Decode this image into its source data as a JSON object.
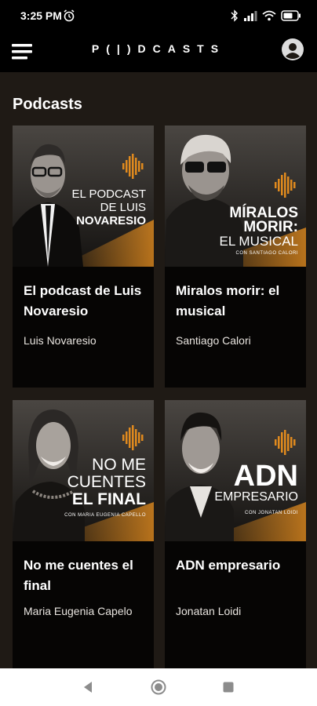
{
  "status": {
    "time": "3:25 PM"
  },
  "app": {
    "logo": "P(|)DCASTS"
  },
  "section": {
    "title": "Podcasts"
  },
  "podcasts": [
    {
      "title": "El podcast de Luis Novaresio",
      "author": "Luis Novaresio",
      "art_line1": "EL PODCAST",
      "art_line2": "DE LUIS",
      "art_line3": "NOVARESIO",
      "art_sub": ""
    },
    {
      "title": "Miralos morir: el musical",
      "author": "Santiago Calori",
      "art_line1": "MÍRALOS",
      "art_line2": "MORIR:",
      "art_line3": "EL MUSICAL",
      "art_sub": "CON SANTIAGO CALORI"
    },
    {
      "title": "No me cuentes el final",
      "author": "Maria Eugenia Capelo",
      "art_line1": "NO ME",
      "art_line2": "CUENTES",
      "art_line3": "EL FINAL",
      "art_sub": "CON MARIA EUGENIA CAPELLO"
    },
    {
      "title": "ADN empresario",
      "author": "Jonatan Loidi",
      "art_line1": "ADN",
      "art_line2": "EMPRESARIO",
      "art_line3": "",
      "art_sub": "CON JONATAN LOIDI"
    }
  ],
  "colors": {
    "accent": "#e08a1e",
    "background": "#1f1a15",
    "card": "#060504"
  },
  "icons": [
    "alarm-icon",
    "bluetooth-icon",
    "signal-icon",
    "wifi-icon",
    "battery-icon",
    "menu-icon",
    "account-icon",
    "back-icon",
    "home-icon",
    "recents-icon",
    "waveform-icon"
  ]
}
